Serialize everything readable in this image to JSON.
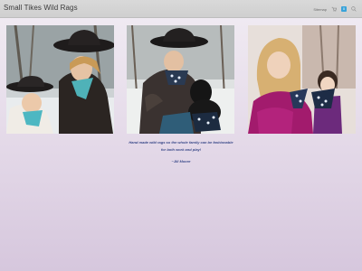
{
  "header": {
    "site_title": "Small Tikes Wild Rags",
    "nav_link": "Sitemap",
    "cart_count": "0"
  },
  "gallery": {
    "photos": [
      {
        "alt": "Two children in cowboy hats with turquoise wild rags in the snow"
      },
      {
        "alt": "Child in black hat and fur coat holding a black puppy in the snow"
      },
      {
        "alt": "Girl in pink jacket holding a doll wearing a wild rag"
      }
    ]
  },
  "testimonial": {
    "quote": "Hand made wild rags so the whole family can be fashionable for both work and play!",
    "author": "~Jill Moore"
  },
  "colors": {
    "topbar": "#d3d3d3",
    "accent": "#3aa3d9",
    "quote_text": "#3b4a8a",
    "page_bg_bottom": "#d6c7dd"
  }
}
